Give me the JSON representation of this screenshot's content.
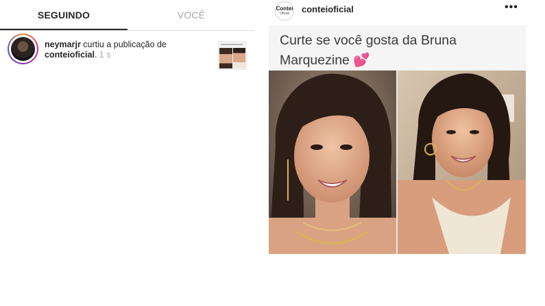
{
  "tabs": {
    "following": "SEGUINDO",
    "you": "VOCÊ"
  },
  "notification": {
    "user": "neymarjr",
    "action": " curtiu a publicação de ",
    "target": "conteioficial",
    "punct": ".",
    "time": " 1 s"
  },
  "post": {
    "avatar_line1": "Contei",
    "avatar_line2": "Oficial",
    "username": "conteioficial",
    "menu": "•••",
    "caption_line1": "Curte se você gosta da Bruna",
    "caption_line2": "Marquezine ",
    "caption_emoji": "💕"
  },
  "icons": {
    "post_menu": "more-horizontal-icon",
    "heart": "two-hearts-emoji"
  },
  "colors": {
    "active_tab": "#262626",
    "inactive_tab": "#a8a8a8",
    "divider": "#dbdbdb",
    "story_ring": "#dd2a7b"
  }
}
